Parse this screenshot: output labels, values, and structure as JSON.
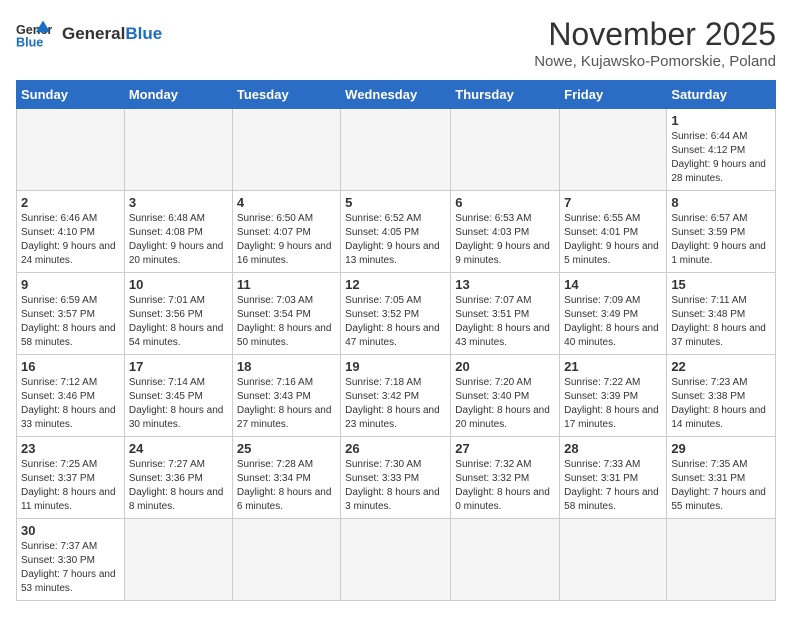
{
  "header": {
    "logo_general": "General",
    "logo_blue": "Blue",
    "month_title": "November 2025",
    "location": "Nowe, Kujawsko-Pomorskie, Poland"
  },
  "weekdays": [
    "Sunday",
    "Monday",
    "Tuesday",
    "Wednesday",
    "Thursday",
    "Friday",
    "Saturday"
  ],
  "weeks": [
    [
      {
        "day": "",
        "info": ""
      },
      {
        "day": "",
        "info": ""
      },
      {
        "day": "",
        "info": ""
      },
      {
        "day": "",
        "info": ""
      },
      {
        "day": "",
        "info": ""
      },
      {
        "day": "",
        "info": ""
      },
      {
        "day": "1",
        "info": "Sunrise: 6:44 AM\nSunset: 4:12 PM\nDaylight: 9 hours and 28 minutes."
      }
    ],
    [
      {
        "day": "2",
        "info": "Sunrise: 6:46 AM\nSunset: 4:10 PM\nDaylight: 9 hours and 24 minutes."
      },
      {
        "day": "3",
        "info": "Sunrise: 6:48 AM\nSunset: 4:08 PM\nDaylight: 9 hours and 20 minutes."
      },
      {
        "day": "4",
        "info": "Sunrise: 6:50 AM\nSunset: 4:07 PM\nDaylight: 9 hours and 16 minutes."
      },
      {
        "day": "5",
        "info": "Sunrise: 6:52 AM\nSunset: 4:05 PM\nDaylight: 9 hours and 13 minutes."
      },
      {
        "day": "6",
        "info": "Sunrise: 6:53 AM\nSunset: 4:03 PM\nDaylight: 9 hours and 9 minutes."
      },
      {
        "day": "7",
        "info": "Sunrise: 6:55 AM\nSunset: 4:01 PM\nDaylight: 9 hours and 5 minutes."
      },
      {
        "day": "8",
        "info": "Sunrise: 6:57 AM\nSunset: 3:59 PM\nDaylight: 9 hours and 1 minute."
      }
    ],
    [
      {
        "day": "9",
        "info": "Sunrise: 6:59 AM\nSunset: 3:57 PM\nDaylight: 8 hours and 58 minutes."
      },
      {
        "day": "10",
        "info": "Sunrise: 7:01 AM\nSunset: 3:56 PM\nDaylight: 8 hours and 54 minutes."
      },
      {
        "day": "11",
        "info": "Sunrise: 7:03 AM\nSunset: 3:54 PM\nDaylight: 8 hours and 50 minutes."
      },
      {
        "day": "12",
        "info": "Sunrise: 7:05 AM\nSunset: 3:52 PM\nDaylight: 8 hours and 47 minutes."
      },
      {
        "day": "13",
        "info": "Sunrise: 7:07 AM\nSunset: 3:51 PM\nDaylight: 8 hours and 43 minutes."
      },
      {
        "day": "14",
        "info": "Sunrise: 7:09 AM\nSunset: 3:49 PM\nDaylight: 8 hours and 40 minutes."
      },
      {
        "day": "15",
        "info": "Sunrise: 7:11 AM\nSunset: 3:48 PM\nDaylight: 8 hours and 37 minutes."
      }
    ],
    [
      {
        "day": "16",
        "info": "Sunrise: 7:12 AM\nSunset: 3:46 PM\nDaylight: 8 hours and 33 minutes."
      },
      {
        "day": "17",
        "info": "Sunrise: 7:14 AM\nSunset: 3:45 PM\nDaylight: 8 hours and 30 minutes."
      },
      {
        "day": "18",
        "info": "Sunrise: 7:16 AM\nSunset: 3:43 PM\nDaylight: 8 hours and 27 minutes."
      },
      {
        "day": "19",
        "info": "Sunrise: 7:18 AM\nSunset: 3:42 PM\nDaylight: 8 hours and 23 minutes."
      },
      {
        "day": "20",
        "info": "Sunrise: 7:20 AM\nSunset: 3:40 PM\nDaylight: 8 hours and 20 minutes."
      },
      {
        "day": "21",
        "info": "Sunrise: 7:22 AM\nSunset: 3:39 PM\nDaylight: 8 hours and 17 minutes."
      },
      {
        "day": "22",
        "info": "Sunrise: 7:23 AM\nSunset: 3:38 PM\nDaylight: 8 hours and 14 minutes."
      }
    ],
    [
      {
        "day": "23",
        "info": "Sunrise: 7:25 AM\nSunset: 3:37 PM\nDaylight: 8 hours and 11 minutes."
      },
      {
        "day": "24",
        "info": "Sunrise: 7:27 AM\nSunset: 3:36 PM\nDaylight: 8 hours and 8 minutes."
      },
      {
        "day": "25",
        "info": "Sunrise: 7:28 AM\nSunset: 3:34 PM\nDaylight: 8 hours and 6 minutes."
      },
      {
        "day": "26",
        "info": "Sunrise: 7:30 AM\nSunset: 3:33 PM\nDaylight: 8 hours and 3 minutes."
      },
      {
        "day": "27",
        "info": "Sunrise: 7:32 AM\nSunset: 3:32 PM\nDaylight: 8 hours and 0 minutes."
      },
      {
        "day": "28",
        "info": "Sunrise: 7:33 AM\nSunset: 3:31 PM\nDaylight: 7 hours and 58 minutes."
      },
      {
        "day": "29",
        "info": "Sunrise: 7:35 AM\nSunset: 3:31 PM\nDaylight: 7 hours and 55 minutes."
      }
    ],
    [
      {
        "day": "30",
        "info": "Sunrise: 7:37 AM\nSunset: 3:30 PM\nDaylight: 7 hours and 53 minutes."
      },
      {
        "day": "",
        "info": ""
      },
      {
        "day": "",
        "info": ""
      },
      {
        "day": "",
        "info": ""
      },
      {
        "day": "",
        "info": ""
      },
      {
        "day": "",
        "info": ""
      },
      {
        "day": "",
        "info": ""
      }
    ]
  ]
}
